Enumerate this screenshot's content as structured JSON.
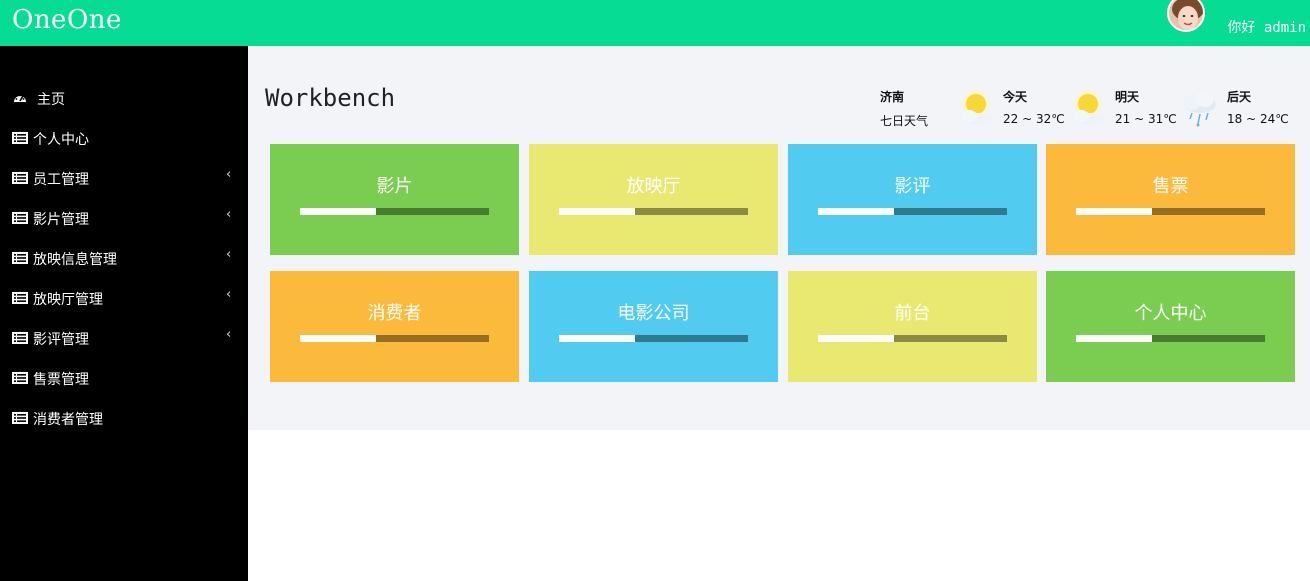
{
  "header": {
    "brand": "OneOne",
    "greeting": "你好 admin",
    "accent": "#07dc95"
  },
  "sidebar": {
    "items": [
      {
        "label": "主页",
        "icon": "dashboard-icon",
        "has_submenu": false
      },
      {
        "label": "个人中心",
        "icon": "list-icon",
        "has_submenu": false
      },
      {
        "label": "员工管理",
        "icon": "list-icon",
        "has_submenu": true
      },
      {
        "label": "影片管理",
        "icon": "list-icon",
        "has_submenu": true
      },
      {
        "label": "放映信息管理",
        "icon": "list-icon",
        "has_submenu": true
      },
      {
        "label": "放映厅管理",
        "icon": "list-icon",
        "has_submenu": true
      },
      {
        "label": "影评管理",
        "icon": "list-icon",
        "has_submenu": true
      },
      {
        "label": "售票管理",
        "icon": "list-icon",
        "has_submenu": false
      },
      {
        "label": "消费者管理",
        "icon": "list-icon",
        "has_submenu": false
      }
    ],
    "chevron": "‹"
  },
  "main": {
    "title": "Workbench"
  },
  "weather": {
    "city": "济南",
    "subtitle": "七日天气",
    "days": [
      {
        "label": "今天",
        "temp": "22 ~ 32℃",
        "icon": "sunny-cloud-icon"
      },
      {
        "label": "明天",
        "temp": "21 ~ 31℃",
        "icon": "sunny-cloud-icon"
      },
      {
        "label": "后天",
        "temp": "18 ~ 24℃",
        "icon": "rain-cloud-icon"
      }
    ]
  },
  "tiles": [
    {
      "label": "影片",
      "color": "#7acd50",
      "progress": 0.4
    },
    {
      "label": "放映厅",
      "color": "#e9e871",
      "progress": 0.4
    },
    {
      "label": "影评",
      "color": "#51cbf0",
      "progress": 0.4
    },
    {
      "label": "售票",
      "color": "#fbba3b",
      "progress": 0.4
    },
    {
      "label": "消费者",
      "color": "#fbba3b",
      "progress": 0.4
    },
    {
      "label": "电影公司",
      "color": "#51cbf0",
      "progress": 0.4
    },
    {
      "label": "前台",
      "color": "#e9e871",
      "progress": 0.4
    },
    {
      "label": "个人中心",
      "color": "#7acd50",
      "progress": 0.4
    }
  ]
}
